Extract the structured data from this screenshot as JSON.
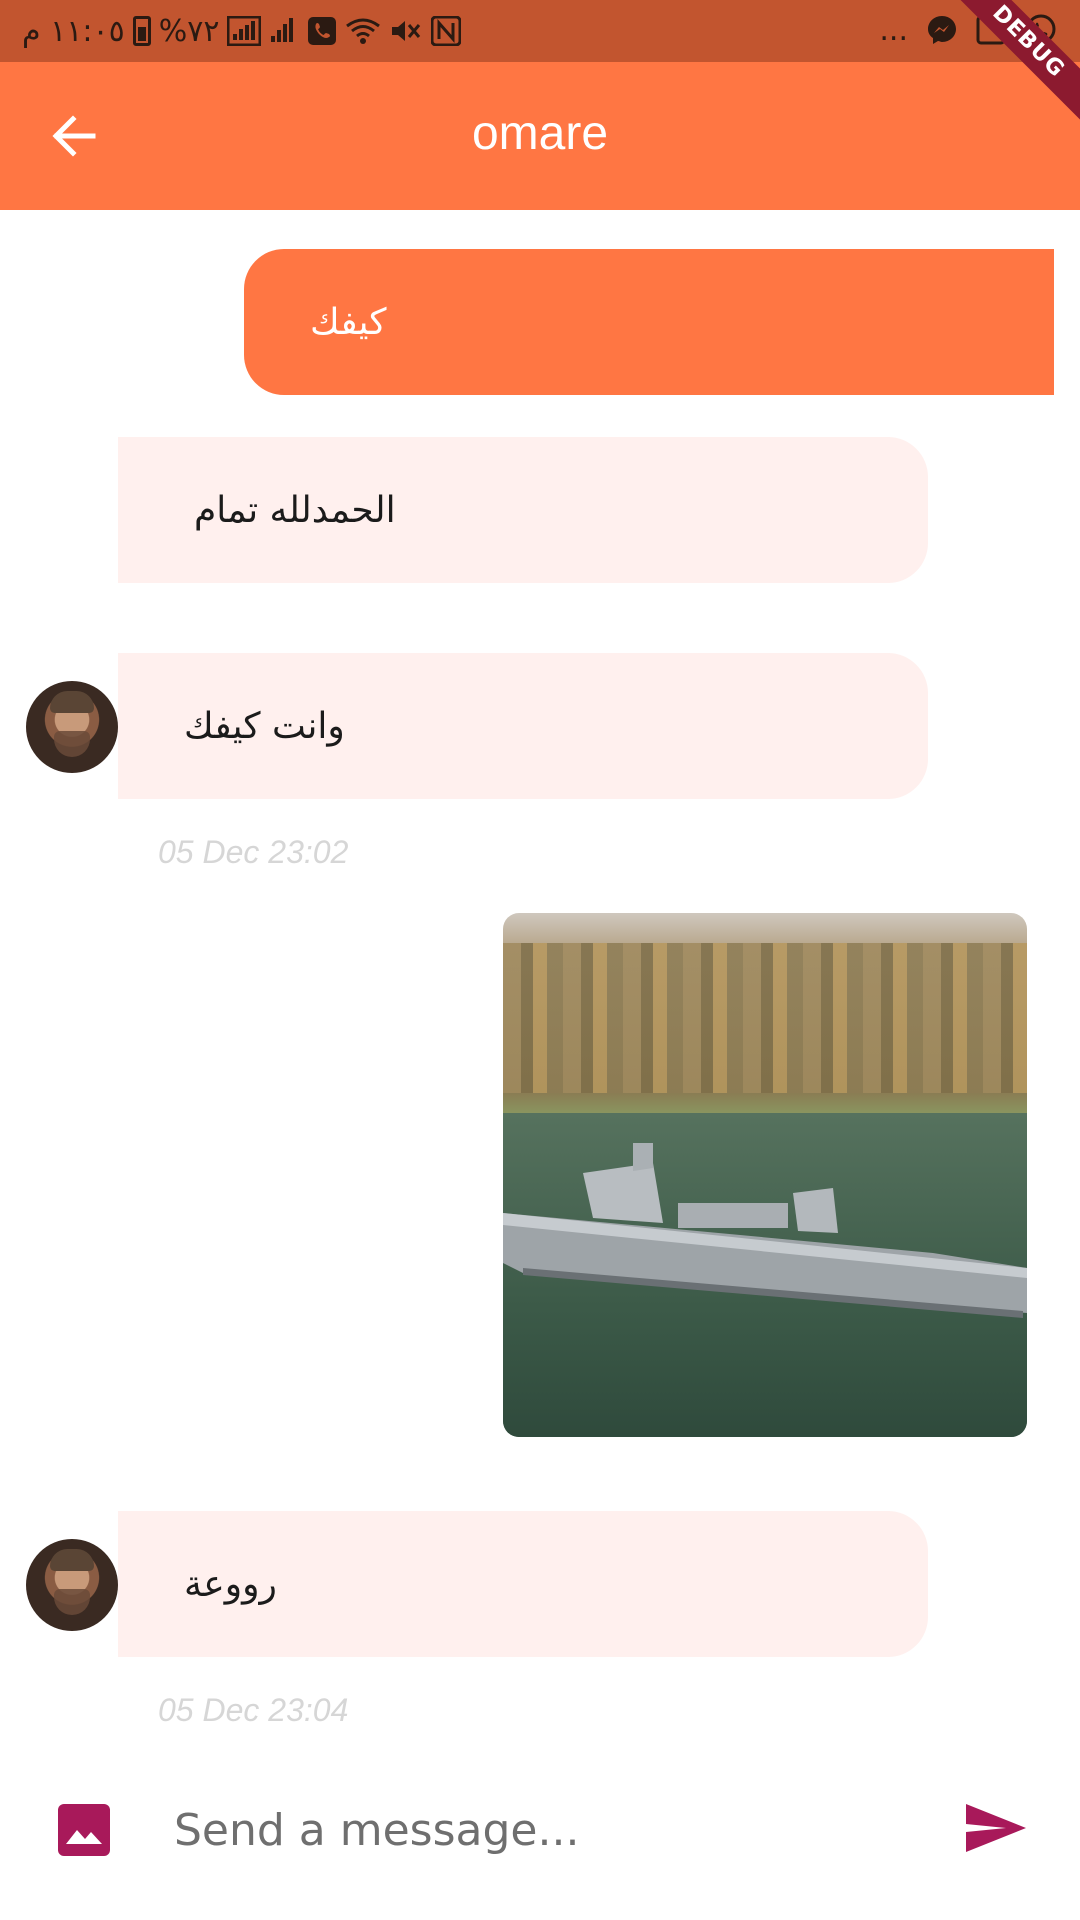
{
  "status_bar": {
    "time": "١١:٠٥ م",
    "battery": "%٧٢",
    "debug_label": "DEBUG",
    "more_label": "..."
  },
  "header": {
    "title": "omare"
  },
  "messages": [
    {
      "direction": "outgoing",
      "text": "كيفك"
    },
    {
      "direction": "incoming",
      "text": "الحمدلله تمام"
    },
    {
      "direction": "incoming",
      "text": "وانت كيفك",
      "timestamp": "05 Dec 23:02"
    },
    {
      "direction": "outgoing",
      "type": "image"
    },
    {
      "direction": "incoming",
      "text": "رووعة",
      "timestamp": "05 Dec 23:04"
    }
  ],
  "composer": {
    "placeholder": "Send a message...",
    "value": ""
  },
  "icons": {
    "back": "arrow-left-icon",
    "image_picker": "image-icon",
    "send": "send-icon"
  },
  "colors": {
    "app_bar": "#ff7643",
    "status_bar": "#c2552f",
    "incoming_bubble": "#fff0ee",
    "outgoing_bubble": "#ff7643",
    "accent": "#a8195a"
  }
}
